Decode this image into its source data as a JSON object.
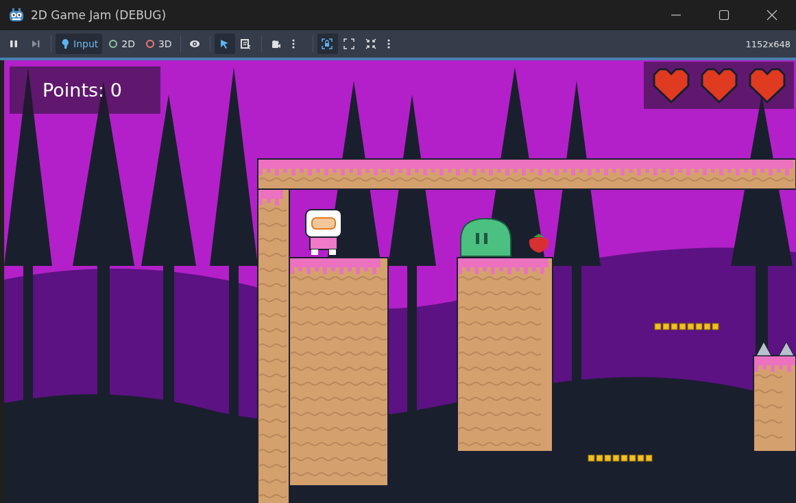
{
  "window": {
    "title": "2D Game Jam (DEBUG)"
  },
  "toolbar": {
    "items": [
      {
        "kind": "pause",
        "selected": false
      },
      {
        "kind": "step",
        "selected": false
      },
      {
        "kind": "input",
        "label": "Input",
        "selected": true
      },
      {
        "kind": "mode2d",
        "label": "2D",
        "selected": false
      },
      {
        "kind": "mode3d",
        "label": "3D",
        "selected": false
      },
      {
        "kind": "eye",
        "selected": false
      },
      {
        "kind": "pointer",
        "selected": true
      },
      {
        "kind": "list-pointer",
        "selected": false
      },
      {
        "kind": "camera",
        "selected": false
      },
      {
        "kind": "more",
        "selected": false
      },
      {
        "kind": "lock",
        "selected": true
      },
      {
        "kind": "expand",
        "selected": false
      },
      {
        "kind": "shrink",
        "selected": false
      },
      {
        "kind": "more",
        "selected": false
      }
    ],
    "resolution": "1152x648"
  },
  "hud": {
    "points": "Points: 0",
    "hearts": [
      {
        "filled": true
      },
      {
        "filled": true
      },
      {
        "filled": true
      }
    ]
  }
}
